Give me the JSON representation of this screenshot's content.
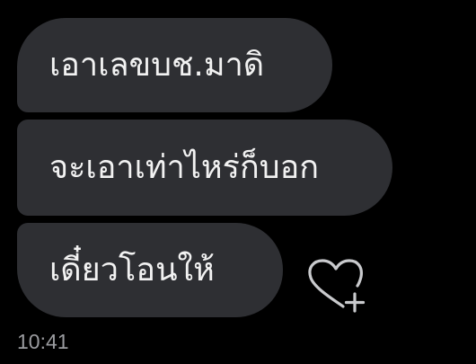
{
  "messages": [
    {
      "text": "เอาเลขบช.มาดิ"
    },
    {
      "text": "จะเอาเท่าไหร่ก็บอก"
    },
    {
      "text": "เดี๋ยวโอนให้"
    }
  ],
  "reaction_icon": "heart-plus-icon",
  "timestamp": "10:41",
  "colors": {
    "background": "#000000",
    "bubble": "#2e2f33",
    "text": "#f2f2f2",
    "timestamp": "#9a9b9f",
    "icon": "#c9cacd"
  }
}
